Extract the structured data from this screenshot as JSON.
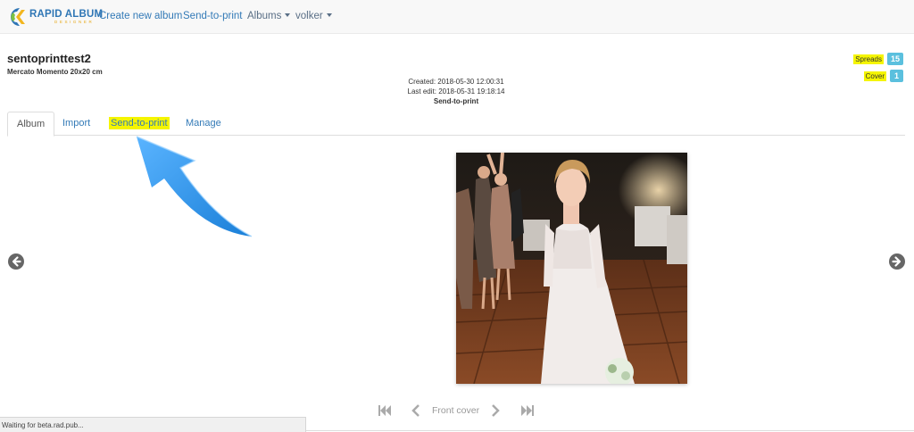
{
  "navbar": {
    "logo_text": "RAPID ALBUM",
    "logo_subtext": "DESIGNER",
    "links": [
      "Create new album",
      "Send-to-print"
    ],
    "albums_label": "Albums",
    "user_label": "volker"
  },
  "album": {
    "title": "sentoprinttest2",
    "product": "Mercato Momento 20x20 cm",
    "created": "Created: 2018-05-30 12:00:31",
    "last_edit": "Last edit: 2018-05-31 19:18:14",
    "status": "Send-to-print"
  },
  "counters": {
    "spreads_label": "Spreads",
    "spreads_value": "15",
    "cover_label": "Cover",
    "cover_value": "1"
  },
  "tabs": [
    "Album",
    "Import",
    "Send-to-print",
    "Manage"
  ],
  "pager": {
    "label": "Front cover"
  },
  "statusbar": {
    "text": "Waiting for beta.rad.pub..."
  },
  "colors": {
    "link": "#337ab7",
    "highlight": "#f5f500",
    "badge": "#5bc0de",
    "annotation_arrow": "#2a8ee6"
  }
}
